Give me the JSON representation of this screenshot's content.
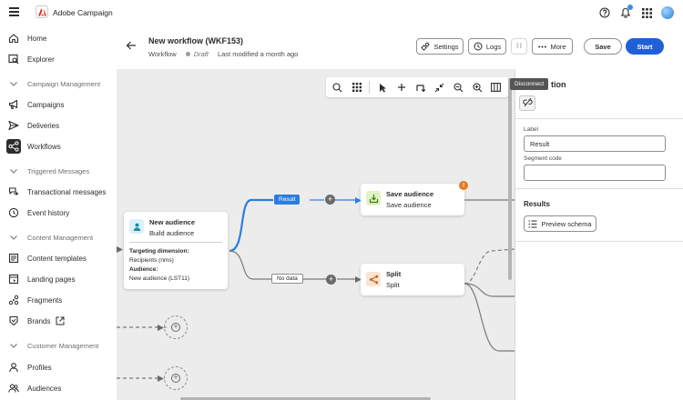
{
  "app": {
    "brand_name": "Adobe Campaign",
    "icons": [
      "menu-icon",
      "adobe-logo",
      "help-icon",
      "notification-bell-icon",
      "apps-grid-icon",
      "user-avatar"
    ]
  },
  "sidebar": {
    "items": [
      {
        "label": "Home",
        "icon": "home-icon"
      },
      {
        "label": "Explorer",
        "icon": "explorer-icon"
      },
      {
        "label": "Campaign Management",
        "type": "section"
      },
      {
        "label": "Campaigns",
        "icon": "megaphone-icon"
      },
      {
        "label": "Deliveries",
        "icon": "send-icon"
      },
      {
        "label": "Workflows",
        "icon": "workflow-icon",
        "active": true
      },
      {
        "label": "Triggered Messages",
        "type": "section"
      },
      {
        "label": "Transactional messages",
        "icon": "transactional-icon"
      },
      {
        "label": "Event history",
        "icon": "history-icon"
      },
      {
        "label": "Content Management",
        "type": "section"
      },
      {
        "label": "Content templates",
        "icon": "template-icon"
      },
      {
        "label": "Landing pages",
        "icon": "landing-page-icon"
      },
      {
        "label": "Fragments",
        "icon": "fragments-icon"
      },
      {
        "label": "Brands",
        "icon": "brands-icon"
      },
      {
        "label": "Customer Management",
        "type": "section"
      },
      {
        "label": "Profiles",
        "icon": "profile-icon"
      },
      {
        "label": "Audiences",
        "icon": "audiences-icon"
      }
    ]
  },
  "header": {
    "title": "New workflow (WKF153)",
    "breadcrumb": "Workflow",
    "status": "Draft",
    "modified": "Last modified a month ago",
    "buttons": {
      "settings": "Settings",
      "logs": "Logs",
      "more": "More",
      "save": "Save",
      "start": "Start"
    }
  },
  "canvas": {
    "nodes": {
      "new_audience": {
        "title": "New audience",
        "subtitle": "Build audience",
        "targeting_label": "Targeting dimension:",
        "targeting_value": "Recipients (nms)",
        "audience_label": "Audience:",
        "audience_value": "New audience (LST11)"
      },
      "save_audience": {
        "title": "Save audience",
        "subtitle": "Save audience",
        "warning": "!"
      },
      "split": {
        "title": "Split",
        "subtitle": "Split"
      }
    },
    "edges": {
      "result": "Result",
      "no_data": "No data"
    }
  },
  "panel": {
    "tooltip": "Disconnect",
    "heading_visible": "tion",
    "label_field_label": "Label",
    "label_field_value": "Result",
    "segment_code_label": "Segment code",
    "segment_code_value": "",
    "results_heading": "Results",
    "preview_schema_button": "Preview schema"
  },
  "colors": {
    "accent": "#1f60d6",
    "edge_active": "#2b7de0",
    "warning": "#e87a1f",
    "canvas_bg": "#ececec"
  }
}
